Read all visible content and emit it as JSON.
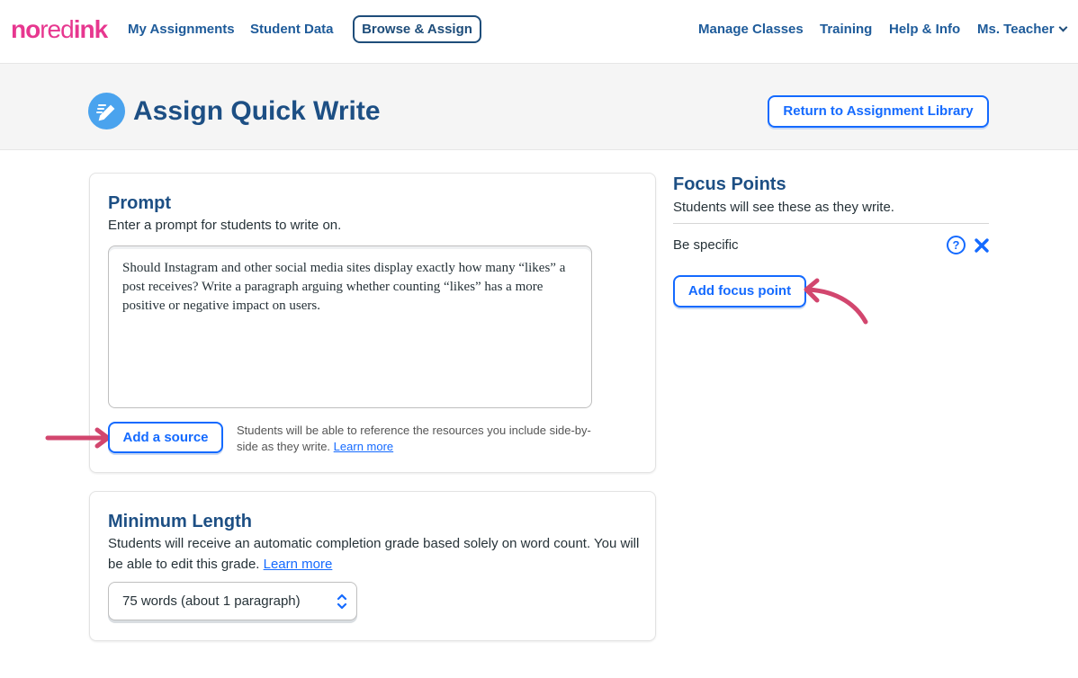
{
  "nav": {
    "logo": {
      "no": "no",
      "red": "red",
      "ink": "ink"
    },
    "items": [
      {
        "label": "My Assignments"
      },
      {
        "label": "Student Data"
      },
      {
        "label": "Browse & Assign"
      },
      {
        "label": "Manage Classes"
      },
      {
        "label": "Training"
      },
      {
        "label": "Help & Info"
      },
      {
        "label": "Ms. Teacher"
      }
    ]
  },
  "header": {
    "title": "Assign Quick Write",
    "icon": "pencil-icon",
    "return_label": "Return to Assignment Library"
  },
  "prompt": {
    "heading": "Prompt",
    "description": "Enter a prompt for students to write on.",
    "text": "Should Instagram and other social media sites display exactly how many “likes” a post receives? Write a paragraph arguing whether counting “likes” has a more positive or negative impact on users.",
    "add_source_label": "Add a source",
    "source_note": "Students will be able to reference the resources you include side-by-side as they write.",
    "learn_more": "Learn more"
  },
  "minimum_length": {
    "heading": "Minimum Length",
    "description": "Students will receive an automatic completion grade based solely on word count. You will be able to edit this grade.",
    "learn_more": "Learn more",
    "selected": "75 words (about 1 paragraph)"
  },
  "focus_points": {
    "heading": "Focus Points",
    "description": "Students will see these as they write.",
    "items": [
      {
        "label": "Be specific"
      }
    ],
    "add_label": "Add focus point"
  },
  "colors": {
    "brand_pink": "#e7378f",
    "navy": "#1d4f84",
    "link_blue": "#146aff",
    "annotation_arrow": "#d2466e"
  }
}
